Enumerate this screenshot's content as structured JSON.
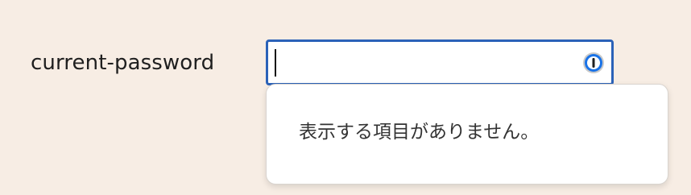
{
  "form": {
    "field_label": "current-password",
    "input_value": "",
    "input_type": "password"
  },
  "password_manager": {
    "icon": "password-manager-icon",
    "accent_color": "#2b62b8",
    "popup_message": "表示する項目がありません。"
  },
  "colors": {
    "page_background": "#f7ede4",
    "focus_ring": "#2b62b8",
    "icon_blue": "#1a73e8"
  }
}
